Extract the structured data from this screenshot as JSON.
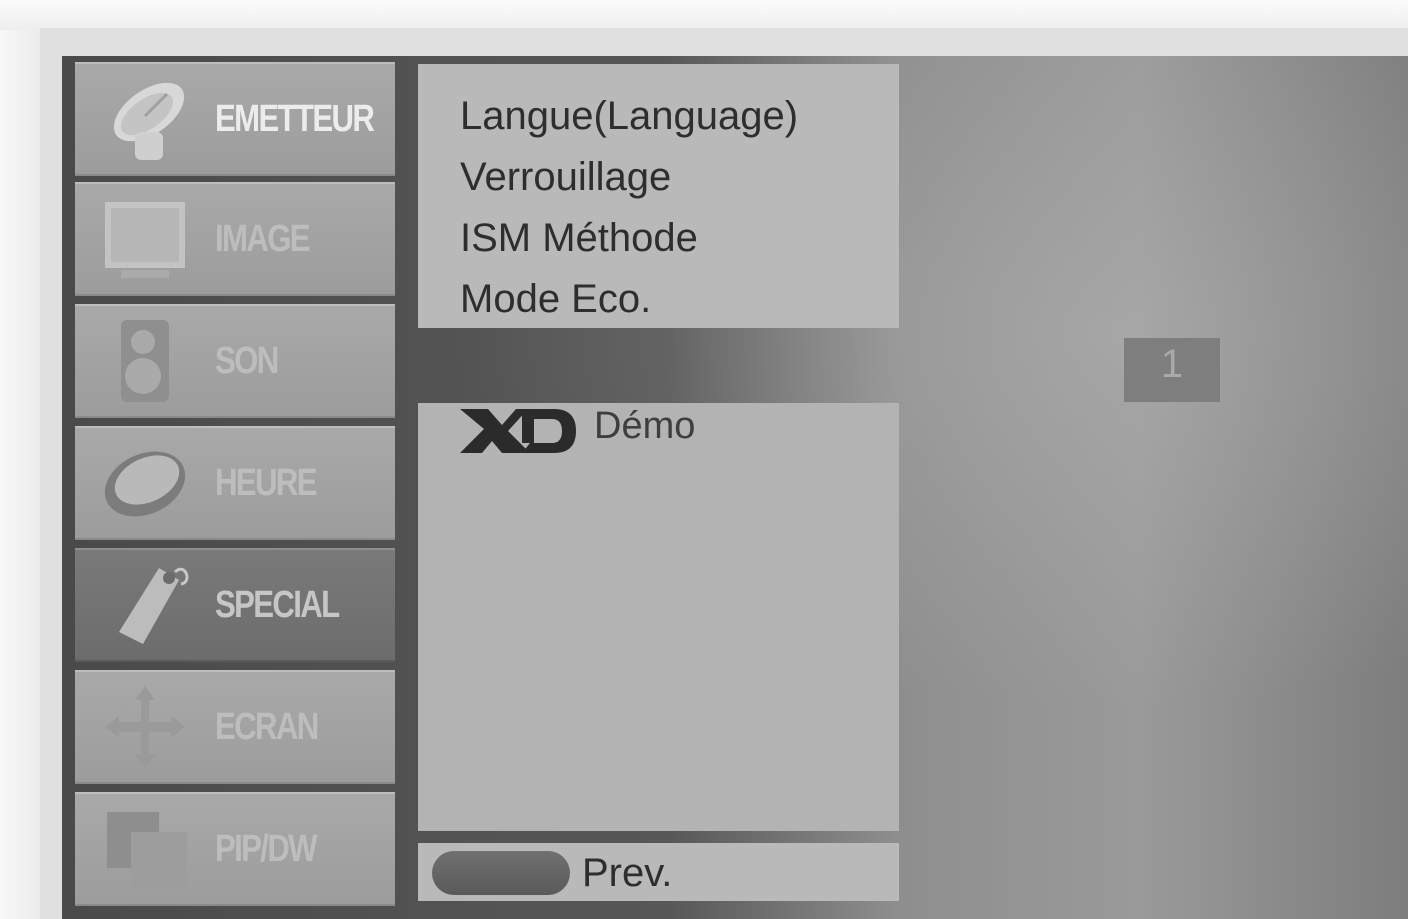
{
  "main_menu": {
    "items": [
      {
        "label": "EMETTEUR",
        "icon": "satellite-dish-icon"
      },
      {
        "label": "IMAGE",
        "icon": "picture-icon"
      },
      {
        "label": "SON",
        "icon": "speaker-icon"
      },
      {
        "label": "HEURE",
        "icon": "clock-icon"
      },
      {
        "label": "SPECIAL",
        "icon": "tag-icon"
      },
      {
        "label": "ECRAN",
        "icon": "move-arrows-icon"
      },
      {
        "label": "PIP/DW",
        "icon": "pip-icon"
      }
    ],
    "selected": "SPECIAL"
  },
  "submenu": {
    "items": [
      "Langue(Language)",
      "Verrouillage",
      "ISM Méthode",
      "Mode Eco."
    ]
  },
  "demo": {
    "logo_text": "XD",
    "label": "Démo"
  },
  "footer": {
    "prev_label": "Prev."
  },
  "channel": {
    "number": "1"
  }
}
